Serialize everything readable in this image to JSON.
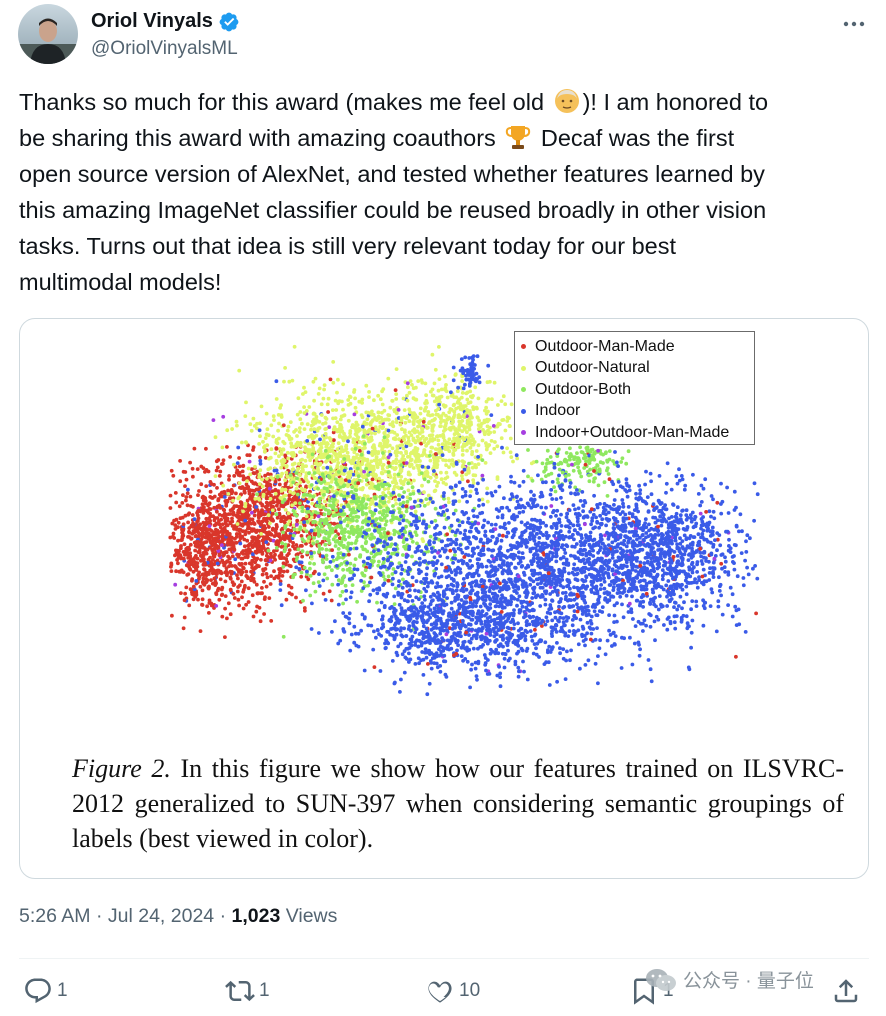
{
  "author": {
    "display_name": "Oriol Vinyals",
    "handle": "@OriolVinyalsML",
    "verified_color": "#1d9bf0"
  },
  "tweet": {
    "lines": [
      {
        "before": "Thanks so much for this award (makes me feel old ",
        "emoji": "older-man-emoji",
        "after": ")! I am honored to"
      },
      {
        "before": "be sharing this award with amazing coauthors ",
        "emoji": "trophy-emoji",
        "after": " Decaf was the first"
      },
      {
        "text": "open source version of AlexNet, and tested whether features learned by"
      },
      {
        "text": "this amazing ImageNet classifier could be reused broadly in other vision"
      },
      {
        "text": "tasks. Turns out that idea is still very relevant today for our best"
      },
      {
        "text": "multimodal models!"
      }
    ]
  },
  "figure": {
    "legend": [
      {
        "label": "Outdoor-Man-Made",
        "color": "#d9362b"
      },
      {
        "label": "Outdoor-Natural",
        "color": "#dff56a"
      },
      {
        "label": "Outdoor-Both",
        "color": "#8fe85f"
      },
      {
        "label": "Indoor",
        "color": "#3a5be8"
      },
      {
        "label": "Indoor+Outdoor-Man-Made",
        "color": "#a63ee0"
      }
    ],
    "caption_label": "Figure 2.",
    "caption_text": " In this figure we show how our features trained on ILSVRC-2012 generalized to SUN-397 when considering semantic groupings of labels (best viewed in color)."
  },
  "meta": {
    "time": "5:26 AM",
    "sep1": " · ",
    "date": "Jul 24, 2024",
    "sep2": " · ",
    "views_count": "1,023",
    "views_label": " Views"
  },
  "actions": {
    "reply_count": "1",
    "retweet_count": "1",
    "like_count": "10",
    "bookmark_count": "1",
    "icon_color": "#536471"
  },
  "watermark": {
    "text": "公众号 · 量子位"
  }
}
